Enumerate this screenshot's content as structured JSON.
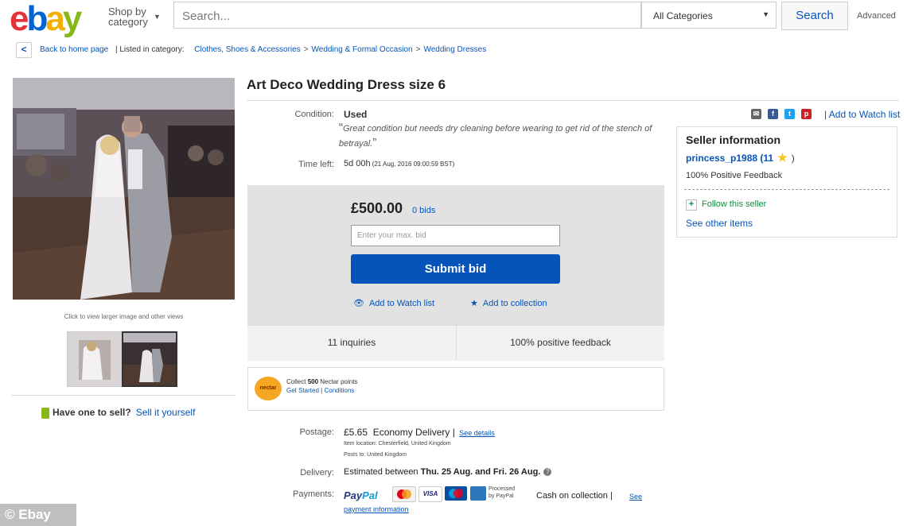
{
  "header": {
    "logo": {
      "e": "e",
      "b": "b",
      "a": "a",
      "y": "y"
    },
    "shop_by_line1": "Shop by",
    "shop_by_line2": "category",
    "search_placeholder": "Search...",
    "category_select": "All Categories",
    "search_button": "Search",
    "advanced_link": "Advanced"
  },
  "breadcrumb": {
    "back": "Back to home page",
    "listed_in": "| Listed in category:",
    "items": [
      "Clothes, Shoes & Accessories",
      "Wedding & Formal Occasion",
      "Wedding Dresses"
    ]
  },
  "gallery": {
    "caption": "Click to view larger image and other views"
  },
  "sell": {
    "question": "Have one to sell?",
    "link": "Sell it yourself"
  },
  "listing": {
    "title": "Art Deco Wedding Dress size 6",
    "condition_label": "Condition:",
    "condition_value": "Used",
    "condition_note": "Great condition but needs dry cleaning before wearing to get rid of the stench of betrayal.",
    "time_label": "Time left:",
    "time_value": "5d 00h",
    "time_detail": "(21 Aug, 2016   09:00:59 BST)"
  },
  "bid": {
    "price": "£500.00",
    "bids": "0 bids",
    "input_placeholder": "Enter your max. bid",
    "submit": "Submit bid",
    "watch": "Add to Watch list",
    "collection": "Add to collection",
    "inquiries": "11 inquiries",
    "feedback": "100% positive feedback"
  },
  "nectar": {
    "logo": "nectar",
    "collect_pre": "Collect",
    "points": "500",
    "collect_post": "Nectar points",
    "get_started": "Get Started",
    "sep": "|",
    "conditions": "Conditions"
  },
  "shipping": {
    "postage_label": "Postage:",
    "postage_price": "£5.65",
    "postage_type": "Economy Delivery",
    "sep": "|",
    "see_details": "See details",
    "item_location": "Item location:  Chesterfield, United Kingdom",
    "posts_to": "Posts to:  United Kingdom",
    "delivery_label": "Delivery:",
    "delivery_pre": "Estimated between",
    "delivery_dates": "Thu. 25 Aug. and Fri. 26 Aug.",
    "help": "?",
    "payments_label": "Payments:",
    "paypal_1": "Pay",
    "paypal_2": "Pal",
    "processed_1": "Processed",
    "processed_2": "by PayPal",
    "cash": "Cash on collection  |",
    "see": "See",
    "payment_info": "payment information"
  },
  "share": {
    "watch": "| Add to Watch list",
    "icons": [
      "email-icon",
      "facebook-icon",
      "twitter-icon",
      "pinterest-icon"
    ]
  },
  "seller": {
    "title": "Seller information",
    "name": "princess_p1988",
    "score_open": "(11",
    "score_close": ")",
    "feedback": "100% Positive Feedback",
    "follow": "Follow this seller",
    "other_items": "See other items"
  },
  "watermark": "© Ebay",
  "colors": {
    "brand_blue": "#0654ba",
    "ebay_red": "#e53238",
    "ebay_blue": "#0064d2",
    "ebay_yellow": "#f5af02",
    "ebay_green": "#86b817"
  }
}
